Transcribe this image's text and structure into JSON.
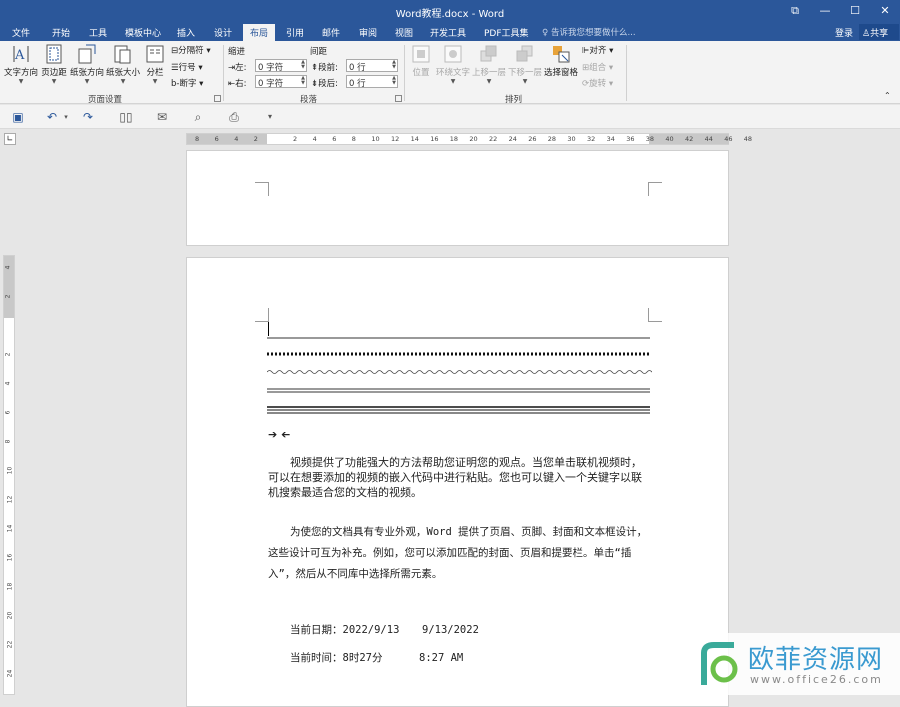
{
  "window": {
    "title": "Word教程.docx - Word",
    "minimize": "—",
    "maximize": "☐",
    "close": "✕",
    "ribbon_display": "⧉"
  },
  "tabs": [
    "文件",
    "开始",
    "工具",
    "模板中心",
    "插入",
    "设计",
    "布局",
    "引用",
    "邮件",
    "审阅",
    "视图",
    "开发工具",
    "PDF工具集"
  ],
  "active_tab": "布局",
  "tell_me": "告诉我您想要做什么...",
  "login": "登录",
  "share": "共享",
  "ribbon": {
    "page_setup": {
      "text_dir": "文字方向",
      "margins": "页边距",
      "orientation": "纸张方向",
      "size": "纸张大小",
      "columns": "分栏",
      "breaks": "分隔符",
      "line_numbers": "行号",
      "hyphenation": "断字",
      "group": "页面设置"
    },
    "paragraph": {
      "indent": "缩进",
      "spacing": "间距",
      "left_label": "左:",
      "right_label": "右:",
      "before_label": "段前:",
      "after_label": "段后:",
      "left_val": "0 字符",
      "right_val": "0 字符",
      "before_val": "0 行",
      "after_val": "0 行",
      "group": "段落"
    },
    "arrange": {
      "position": "位置",
      "wrap": "环绕文字",
      "forward": "上移一层",
      "backward": "下移一层",
      "pane": "选择窗格",
      "align": "对齐",
      "group_btn": "组合",
      "rotate": "旋转",
      "group": "排列"
    }
  },
  "colors": {
    "accent": "#2b579a",
    "ribbon_bg": "#f3f3f3",
    "canvas": "#e6e6e6"
  },
  "hruler_numbers": [
    "8",
    "6",
    "4",
    "2",
    "",
    "2",
    "4",
    "6",
    "8",
    "10",
    "12",
    "14",
    "16",
    "18",
    "20",
    "22",
    "24",
    "26",
    "28",
    "30",
    "32",
    "34",
    "36",
    "38",
    "40",
    "42",
    "44",
    "46",
    "48"
  ],
  "vruler_numbers": [
    "4",
    "2",
    "",
    "2",
    "4",
    "6",
    "8",
    "10",
    "12",
    "14",
    "16",
    "18",
    "20",
    "22",
    "24"
  ],
  "document": {
    "para1": "视频提供了功能强大的方法帮助您证明您的观点。当您单击联机视频时，可以在想要添加的视频的嵌入代码中进行粘贴。您也可以键入一个关键字以联机搜索最适合您的文档的视频。",
    "para2": "为使您的文档具有专业外观，Word 提供了页眉、页脚、封面和文本框设计，这些设计可互为补充。例如，您可以添加匹配的封面、页眉和提要栏。单击“插入”，然后从不同库中选择所需元素。",
    "date_label": "当前日期：2022/9/13",
    "date_value": "9/13/2022",
    "time_label": "当前时间：8时27分",
    "time_value": "8:27 AM",
    "arrows": "➔ ➔"
  },
  "watermark": {
    "text": "欧菲资源网",
    "url": "www.office26.com"
  }
}
